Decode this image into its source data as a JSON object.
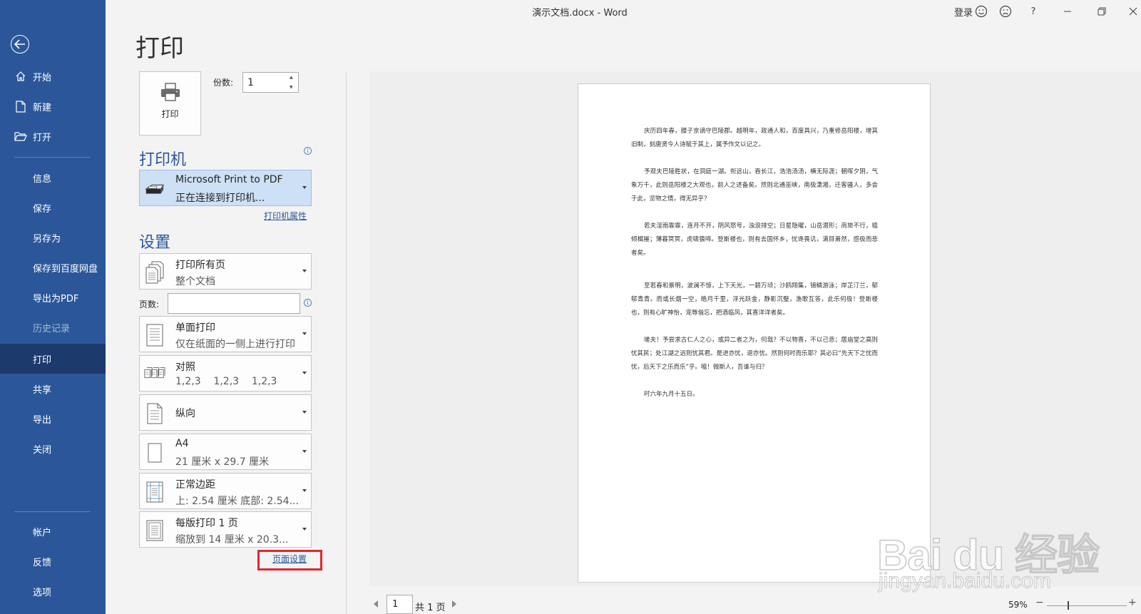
{
  "titlebar": {
    "title": "演示文档.docx  -  Word",
    "signin": "登录",
    "icons": [
      "smile-icon",
      "frown-icon",
      "help-icon",
      "minimize-icon",
      "restore-icon",
      "close-icon"
    ],
    "help": "?"
  },
  "sidebar": {
    "back_icon": "back-arrow-icon",
    "items": [
      {
        "label": "开始",
        "icon": "home-icon"
      },
      {
        "label": "新建",
        "icon": "new-document-icon"
      },
      {
        "label": "打开",
        "icon": "folder-open-icon"
      },
      {
        "label": "信息"
      },
      {
        "label": "保存"
      },
      {
        "label": "另存为"
      },
      {
        "label": "保存到百度网盘"
      },
      {
        "label": "导出为PDF"
      },
      {
        "label": "历史记录",
        "state": "disabled"
      },
      {
        "label": "打印",
        "state": "active"
      },
      {
        "label": "共享"
      },
      {
        "label": "导出"
      },
      {
        "label": "关闭"
      },
      {
        "label": "帐户"
      },
      {
        "label": "反馈"
      },
      {
        "label": "选项"
      }
    ]
  },
  "print": {
    "title": "打印",
    "button_label": "打印",
    "copies_label": "份数:",
    "copies_value": "1"
  },
  "printer": {
    "section_title": "打印机",
    "name": "Microsoft Print to PDF",
    "status": "正在连接到打印机...",
    "properties_link": "打印机属性"
  },
  "settings": {
    "section_title": "设置",
    "pages_label": "页数:",
    "pages_value": "",
    "options": [
      {
        "main": "打印所有页",
        "sub": "整个文档",
        "icon": "all-pages-icon"
      },
      {
        "main": "单面打印",
        "sub": "仅在纸面的一侧上进行打印",
        "icon": "one-sided-icon"
      },
      {
        "main": "对照",
        "sub": "1,2,3    1,2,3    1,2,3",
        "icon": "collated-icon"
      },
      {
        "main": "纵向",
        "sub": "",
        "icon": "portrait-icon"
      },
      {
        "main": "A4",
        "sub": "21 厘米 x 29.7 厘米",
        "icon": "paper-size-icon"
      },
      {
        "main": "正常边距",
        "sub": "上: 2.54 厘米 底部: 2.54...",
        "icon": "margins-icon"
      },
      {
        "main": "每版打印 1 页",
        "sub": "缩放到 14 厘米 x 20.3...",
        "icon": "pages-per-sheet-icon"
      }
    ],
    "page_setup_link": "页面设置"
  },
  "preview": {
    "paragraphs": [
      "庆历四年春，滕子京谪守巴陵郡。越明年，政通人和，百废具兴，乃重修岳阳楼，增其旧制，刻唐贤今人诗赋于其上，属予作文以记之。",
      "予观夫巴陵胜状，在洞庭一湖。衔远山，吞长江，浩浩汤汤，横无际涯；朝晖夕阴，气象万千，此则岳阳楼之大观也，前人之述备矣。然则北通巫峡，南极潇湘，迁客骚人，多会于此，览物之情，得无异乎？",
      "若夫淫雨霏霏，连月不开，阴风怒号，浊浪排空；日星隐曜，山岳潜形；商旅不行，樯倾楫摧；薄暮冥冥，虎啸猿啼。登斯楼也，则有去国怀乡，忧谗畏讥，满目萧然，感极而悲者矣。",
      "至若春和景明，波澜不惊，上下天光，一碧万顷；沙鸥翔集，锦鳞游泳；岸芷汀兰，郁郁青青。而或长烟一空，皓月千里，浮光跃金，静影沉璧，渔歌互答，此乐何极！登斯楼也，则有心旷神怡，宠辱偕忘，把酒临风，其喜洋洋者矣。",
      "嗟夫！予尝求古仁人之心，或异二者之为，何哉？不以物喜，不以己悲；居庙堂之高则忧其民；处江湖之远则忧其君。是进亦忧，退亦忧。然则何时而乐耶？其必曰“先天下之忧而忧，后天下之乐而乐”乎。噫！微斯人，吾谁与归？",
      "时六年九月十五日。"
    ]
  },
  "bottombar": {
    "page_value": "1",
    "page_total": "共 1 页",
    "zoom": "59%",
    "zoom_minus": "−",
    "zoom_plus": "+",
    "zoom_level_fraction": 0.27
  },
  "watermark": {
    "text": "Bai du 经验",
    "url": "jingyan.baidu.com"
  }
}
